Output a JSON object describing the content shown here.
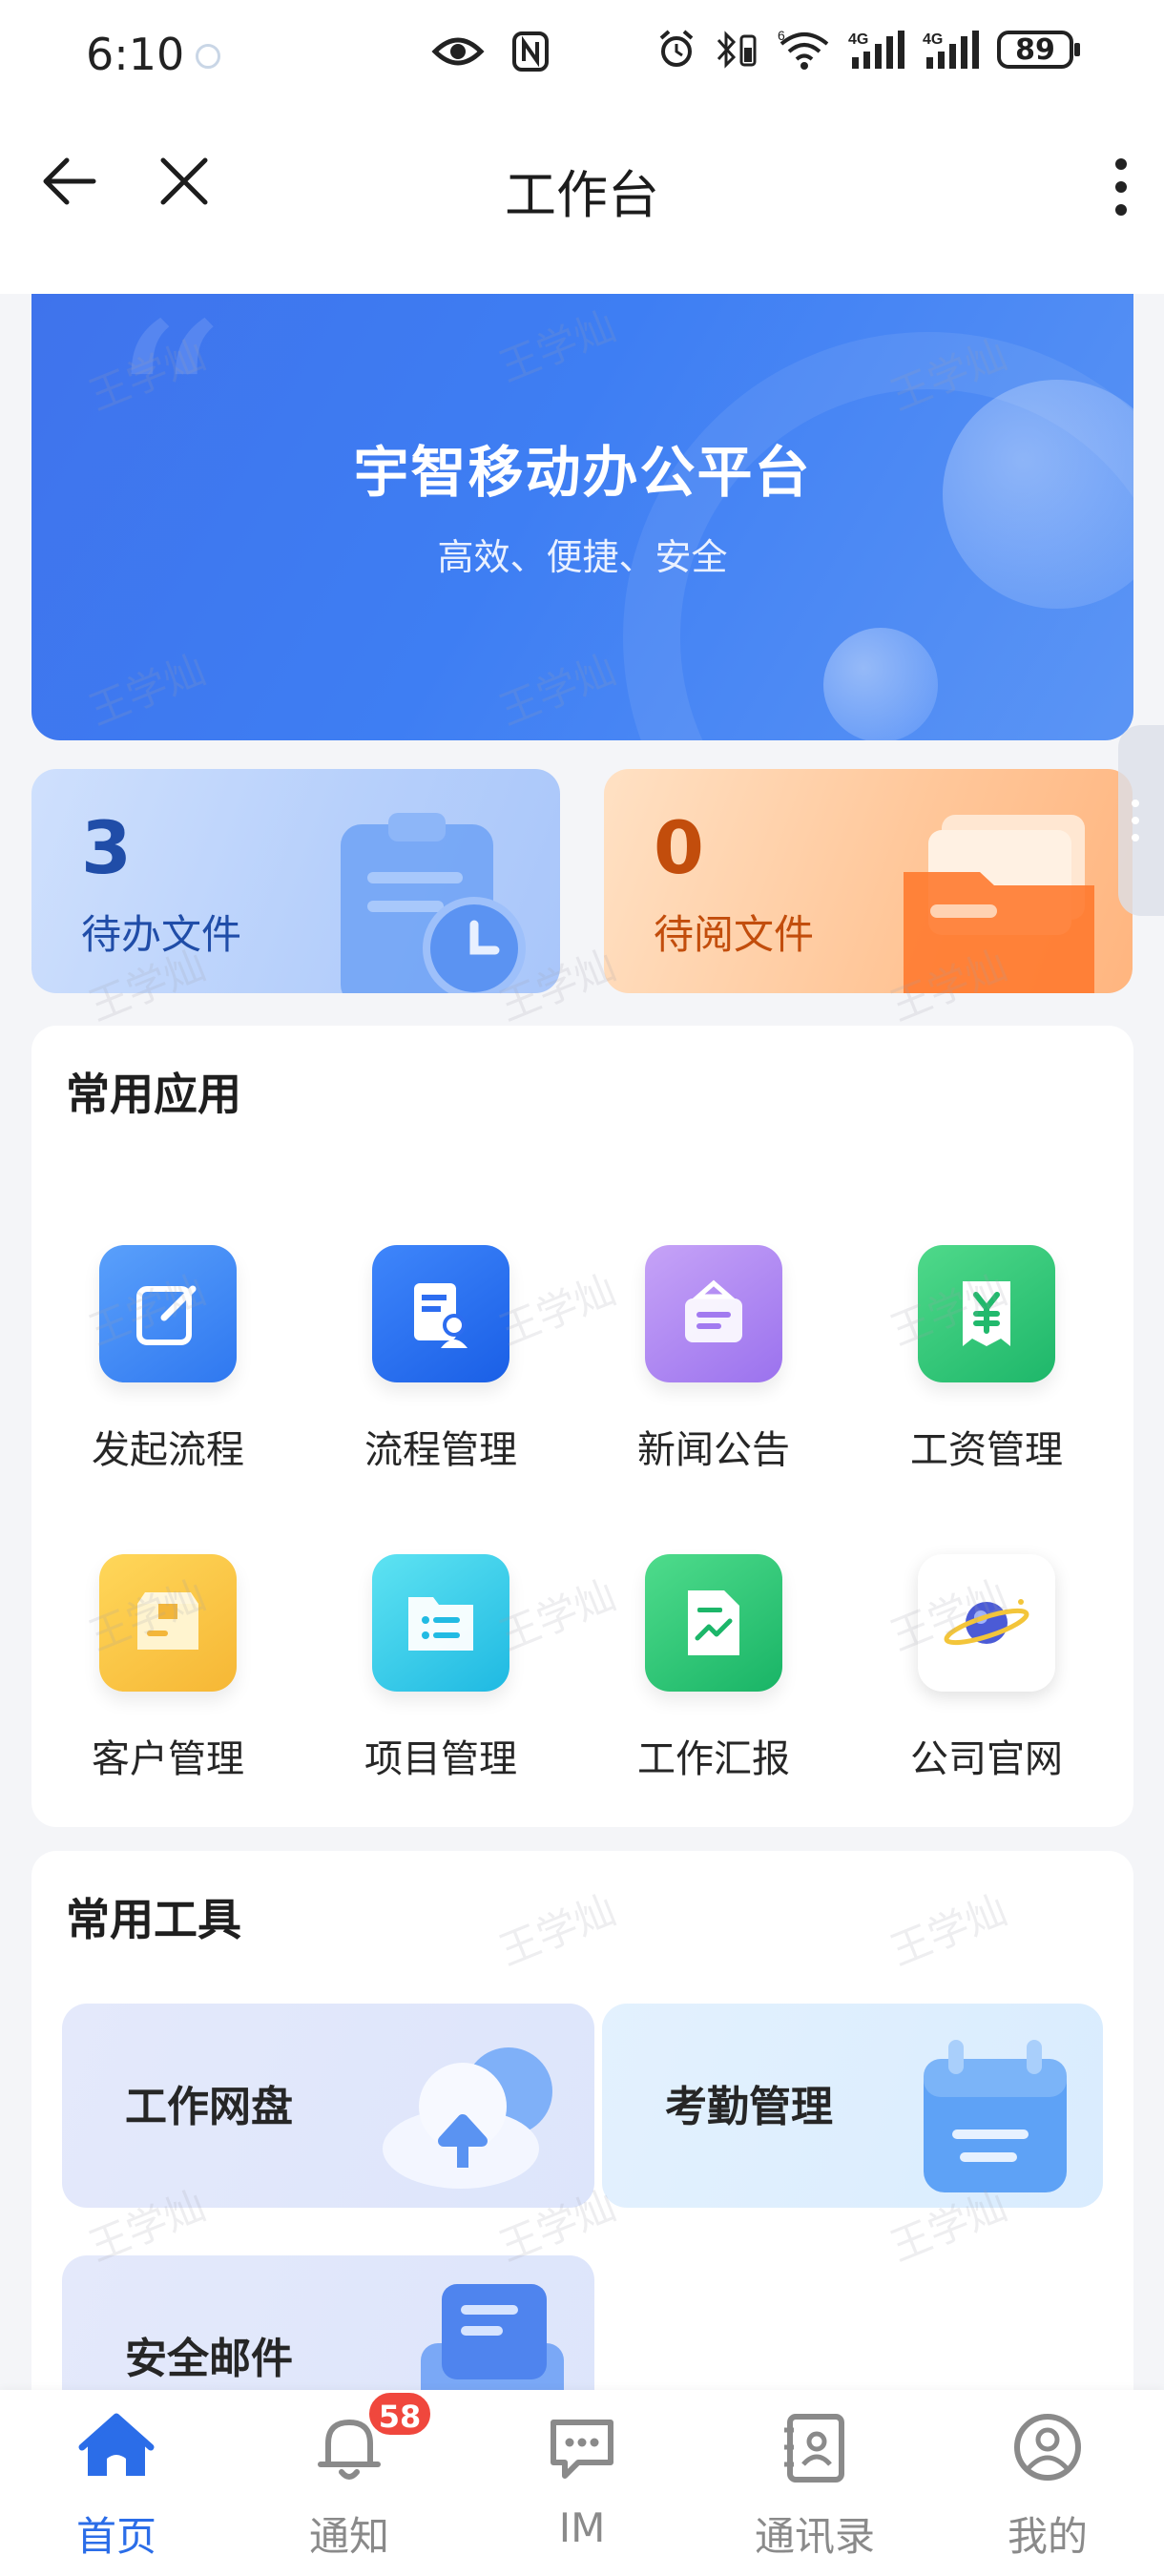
{
  "status_bar": {
    "time": "6:10",
    "signal_1": "4G",
    "signal_2": "4G",
    "wifi_tag": "6",
    "battery": "89"
  },
  "header": {
    "title": "工作台",
    "back_icon": "arrow-left-icon",
    "close_icon": "close-icon",
    "more_icon": "more-vertical-icon"
  },
  "banner": {
    "title": "宇智移动办公平台",
    "subtitle": "高效、便捷、安全"
  },
  "stats": [
    {
      "count": "3",
      "label": "待办文件",
      "color": "#204da8"
    },
    {
      "count": "0",
      "label": "待阅文件",
      "color": "#c24d0c"
    }
  ],
  "common_apps": {
    "title": "常用应用",
    "items": [
      {
        "label": "发起流程",
        "icon": "edit-icon"
      },
      {
        "label": "流程管理",
        "icon": "document-user-icon"
      },
      {
        "label": "新闻公告",
        "icon": "notice-board-icon"
      },
      {
        "label": "工资管理",
        "icon": "yen-receipt-icon"
      },
      {
        "label": "客户管理",
        "icon": "box-icon"
      },
      {
        "label": "项目管理",
        "icon": "folder-list-icon"
      },
      {
        "label": "工作汇报",
        "icon": "report-chart-icon"
      },
      {
        "label": "公司官网",
        "icon": "planet-icon"
      }
    ]
  },
  "common_tools": {
    "title": "常用工具",
    "items": [
      {
        "label": "工作网盘",
        "icon": "cloud-upload-icon"
      },
      {
        "label": "考勤管理",
        "icon": "calendar-icon"
      },
      {
        "label": "安全邮件",
        "icon": "mail-icon"
      }
    ]
  },
  "tabbar": {
    "items": [
      {
        "label": "首页",
        "icon": "home-icon",
        "active": true
      },
      {
        "label": "通知",
        "icon": "bell-icon",
        "badge": "58"
      },
      {
        "label": "IM",
        "icon": "chat-icon"
      },
      {
        "label": "通讯录",
        "icon": "contacts-icon"
      },
      {
        "label": "我的",
        "icon": "user-icon"
      }
    ]
  },
  "watermark": "王学灿",
  "colors": {
    "accent": "#2b6de8",
    "badge": "#f0473d",
    "page_bg": "#f4f5f8"
  }
}
